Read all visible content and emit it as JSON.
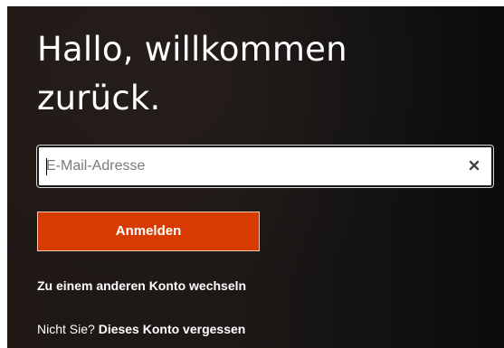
{
  "heading": "Hallo, willkommen zurück.",
  "email": {
    "placeholder": "E-Mail-Adresse",
    "value": "",
    "clear_icon": "close-x-icon"
  },
  "signin_button": "Anmelden",
  "switch_account_link": "Zu einem anderen Konto wechseln",
  "forget": {
    "prefix": "Nicht Sie? ",
    "link": "Dieses Konto vergessen"
  },
  "colors": {
    "accent": "#d83b01",
    "background": "#1c1716",
    "text": "#ffffff"
  }
}
